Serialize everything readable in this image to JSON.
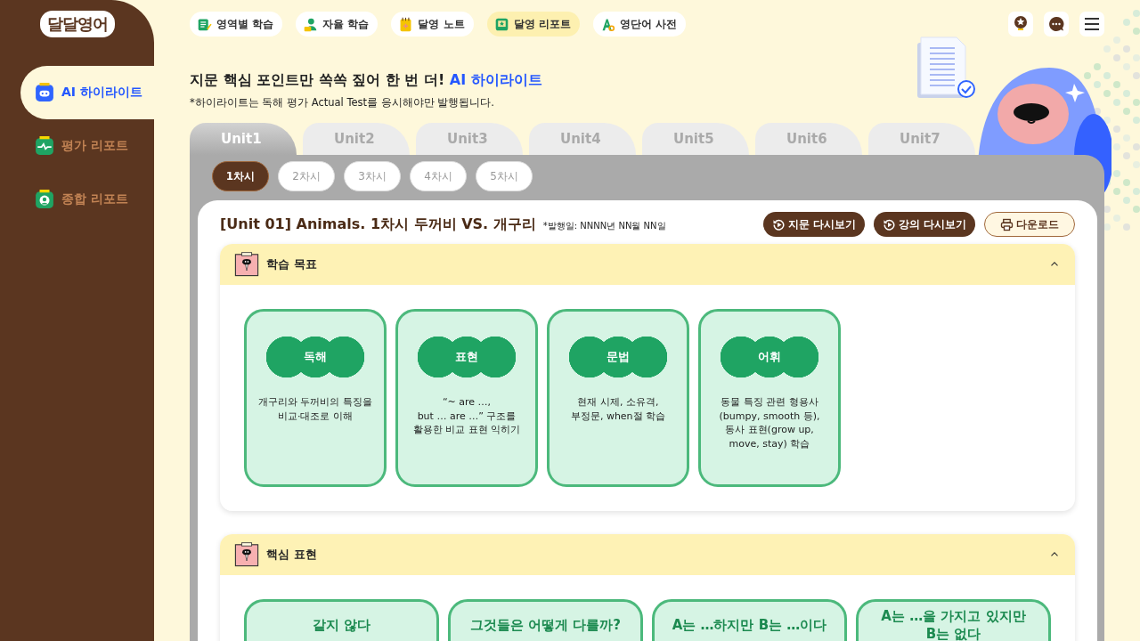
{
  "logo": {
    "text": "달달영어"
  },
  "sidebar": {
    "items": [
      {
        "label": "AI 하이라이트",
        "selected": true,
        "kind": "robot"
      },
      {
        "label": "평가 리포트",
        "selected": false,
        "kind": "pulse"
      },
      {
        "label": "종합 리포트",
        "selected": false,
        "kind": "person"
      }
    ]
  },
  "nav": {
    "items": [
      {
        "label": "영역별 학습",
        "selected": false,
        "kind": "notes"
      },
      {
        "label": "자율 학습",
        "selected": false,
        "kind": "learner"
      },
      {
        "label": "달영 노트",
        "selected": false,
        "kind": "notebook"
      },
      {
        "label": "달영 리포트",
        "selected": true,
        "kind": "report"
      },
      {
        "label": "영단어 사전",
        "selected": false,
        "kind": "dictionary"
      }
    ]
  },
  "header": {
    "headline": "지문 핵심 포인트만 쏙쏙 짚어 한 번 더!",
    "headline_highlight": "AI 하이라이트",
    "note": "*하이라이트는 독해 평가 Actual Test를 응시해야만 발행됩니다."
  },
  "unit_tabs": [
    {
      "label": "Unit1",
      "selected": true
    },
    {
      "label": "Unit2",
      "selected": false
    },
    {
      "label": "Unit3",
      "selected": false
    },
    {
      "label": "Unit4",
      "selected": false
    },
    {
      "label": "Unit5",
      "selected": false
    },
    {
      "label": "Unit6",
      "selected": false
    },
    {
      "label": "Unit7",
      "selected": false
    }
  ],
  "lesson_tabs": [
    {
      "label": "1차시",
      "selected": true
    },
    {
      "label": "2차시",
      "selected": false
    },
    {
      "label": "3차시",
      "selected": false
    },
    {
      "label": "4차시",
      "selected": false
    },
    {
      "label": "5차시",
      "selected": false
    }
  ],
  "lesson": {
    "title": "[Unit 01] Animals. 1차시 두꺼비 VS. 개구리",
    "issued": "*발행일: NNNN년 NN월 NN일",
    "buttons": [
      {
        "label": "지문 다시보기",
        "kind": "replay"
      },
      {
        "label": "강의 다시보기",
        "kind": "replay"
      },
      {
        "label": "다운로드",
        "kind": "print"
      }
    ]
  },
  "sections": [
    {
      "title": "학습 목표",
      "expanded": true,
      "kind": "goals",
      "cards": [
        {
          "tag": "독해",
          "text": "개구리와 두꺼비의 특징을\n비교·대조로 이해"
        },
        {
          "tag": "표현",
          "text": "“~ are …,\nbut … are …” 구조를\n활용한 비교 표현 익히기"
        },
        {
          "tag": "문법",
          "text": "현재 시제, 소유격,\n부정문, when절 학습"
        },
        {
          "tag": "어휘",
          "text": "동물 특징 관련 형용사\n(bumpy, smooth 등),\n동사 표현(grow up,\nmove, stay) 학습"
        }
      ]
    },
    {
      "title": "핵심 표현",
      "expanded": true,
      "kind": "expressions",
      "cards": [
        {
          "text": "같지 않다"
        },
        {
          "text": "그것들은 어떻게 다를까?"
        },
        {
          "text": "A는 …하지만 B는 …이다"
        },
        {
          "text": "A는 …을 가지고 있지만\nB는 없다"
        }
      ]
    }
  ]
}
